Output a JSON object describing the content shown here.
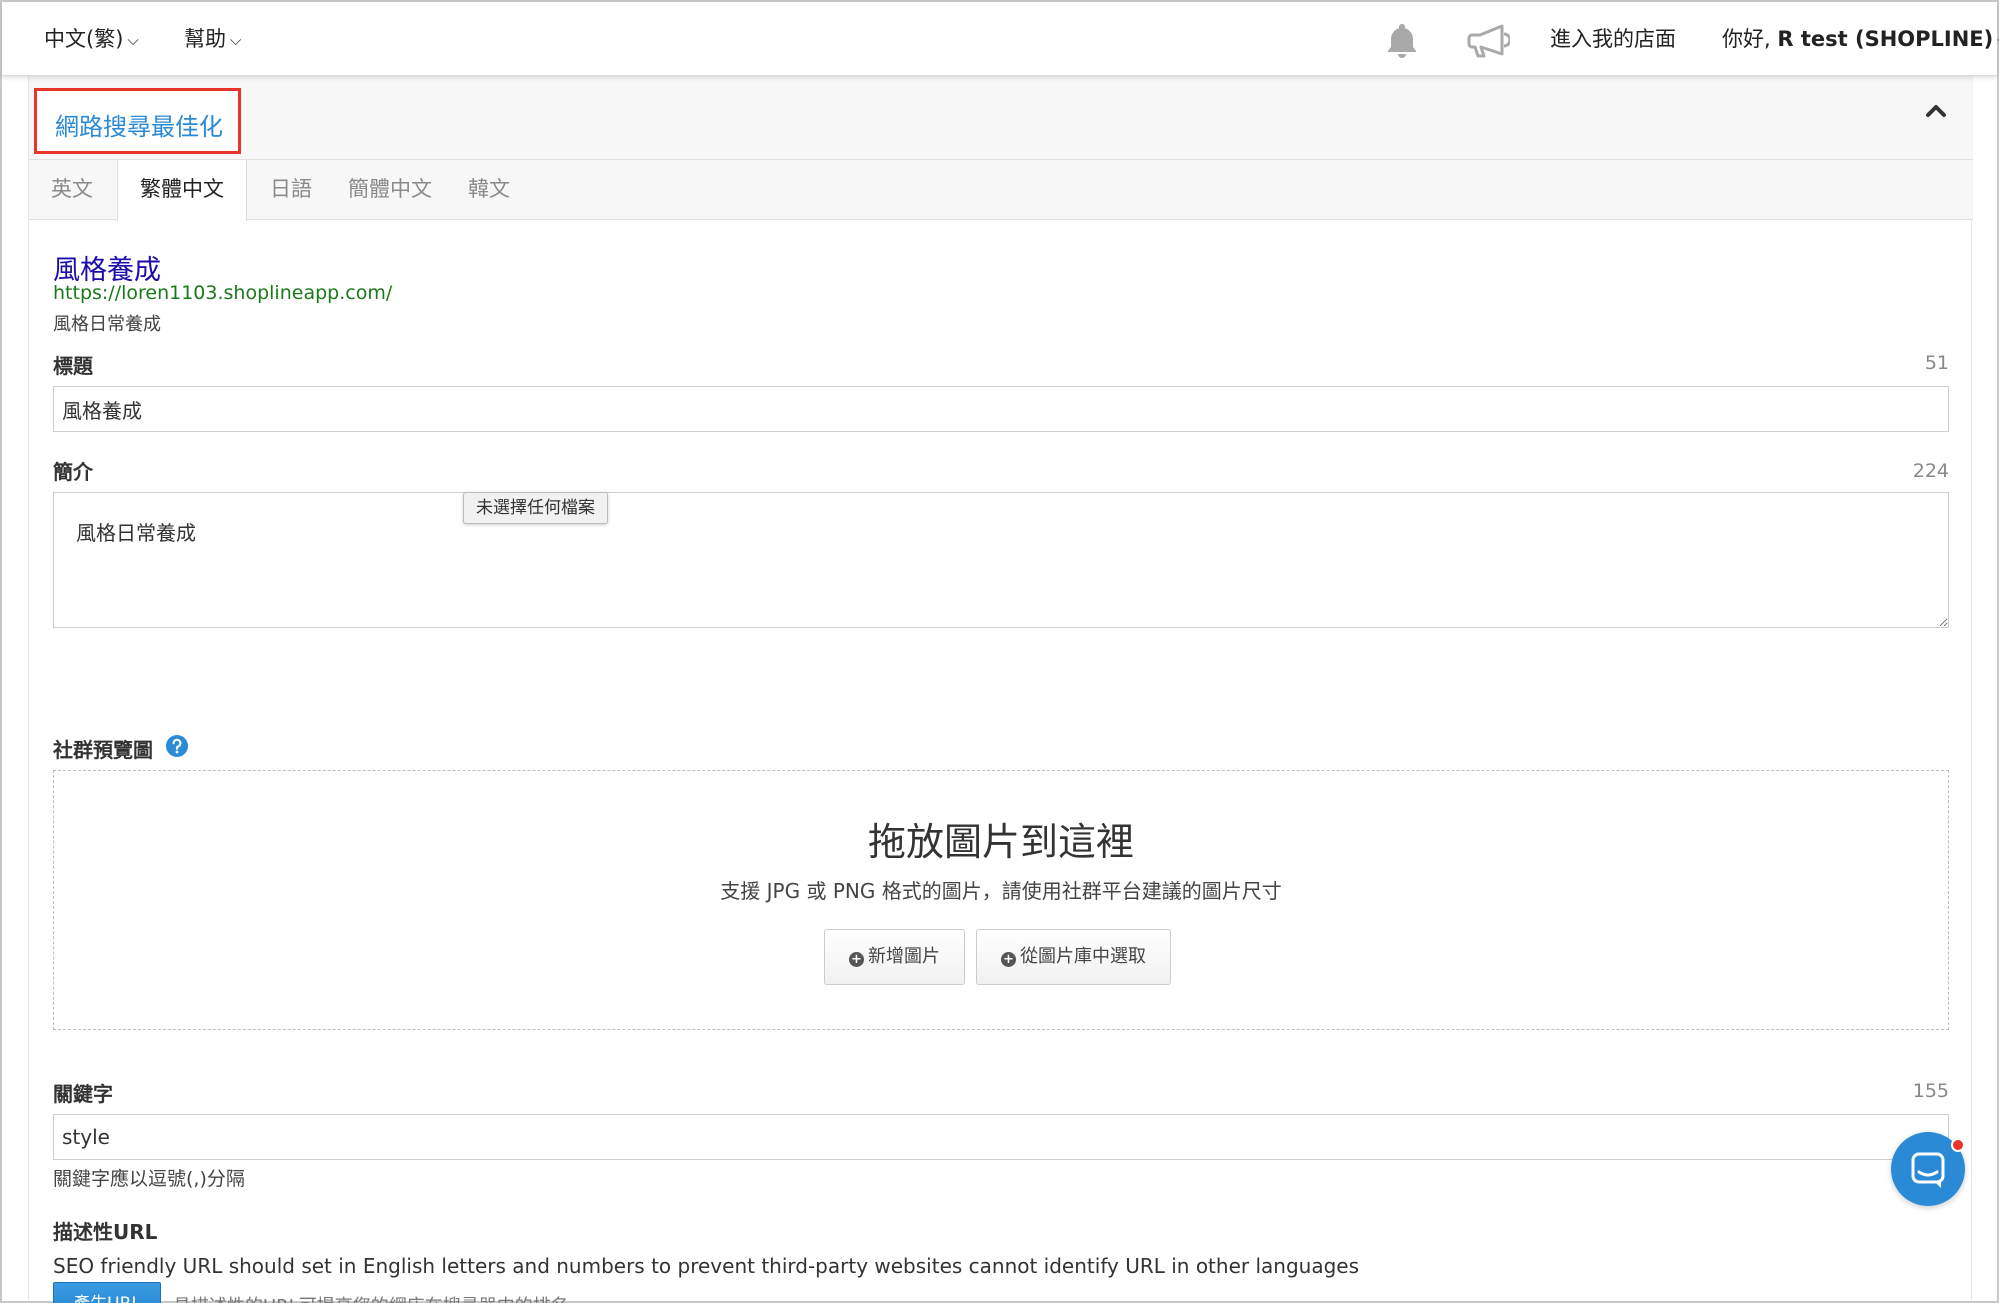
{
  "topbar": {
    "language_label": "中文(繁)",
    "help_label": "幫助",
    "store_link": "進入我的店面",
    "greeting_prefix": "你好,",
    "user_name": "R test (SHOPLINE)",
    "icons": [
      "bell-icon",
      "megaphone-icon",
      "chevron-down-icon"
    ]
  },
  "seo": {
    "section_title": "網路搜尋最佳化",
    "tabs": [
      {
        "label": "英文"
      },
      {
        "label": "繁體中文",
        "active": true
      },
      {
        "label": "日語"
      },
      {
        "label": "簡體中文"
      },
      {
        "label": "韓文"
      }
    ],
    "preview": {
      "title": "風格養成",
      "url": "https://loren1103.shoplineapp.com/",
      "description": "風格日常養成"
    },
    "title_field": {
      "label": "標題",
      "count": "51",
      "value": "風格養成"
    },
    "desc_field": {
      "label": "簡介",
      "count": "224",
      "value": "風格日常養成",
      "tooltip": "未選擇任何檔案"
    },
    "social_image": {
      "label": "社群預覽圖",
      "drop_title": "拖放圖片到這裡",
      "drop_subtitle": "支援 JPG 或 PNG 格式的圖片，請使用社群平台建議的圖片尺寸",
      "add_button": "新增圖片",
      "library_button": "從圖片庫中選取"
    },
    "keywords_field": {
      "label": "關鍵字",
      "count": "155",
      "value": "style",
      "hint": "關鍵字應以逗號(,)分隔"
    },
    "url_field": {
      "label": "描述性URL",
      "note": "SEO friendly URL should set in English letters and numbers to prevent third-party websites cannot identify URL in other languages",
      "generate_button": "產生URL",
      "generate_hint": "具描述性的URL可提高您的網店在搜尋器中的排名"
    }
  },
  "colors": {
    "accent": "#2b8ad6",
    "highlight_border": "#e8342a",
    "preview_title": "#1a0dab",
    "preview_url": "#1a7a1a"
  }
}
